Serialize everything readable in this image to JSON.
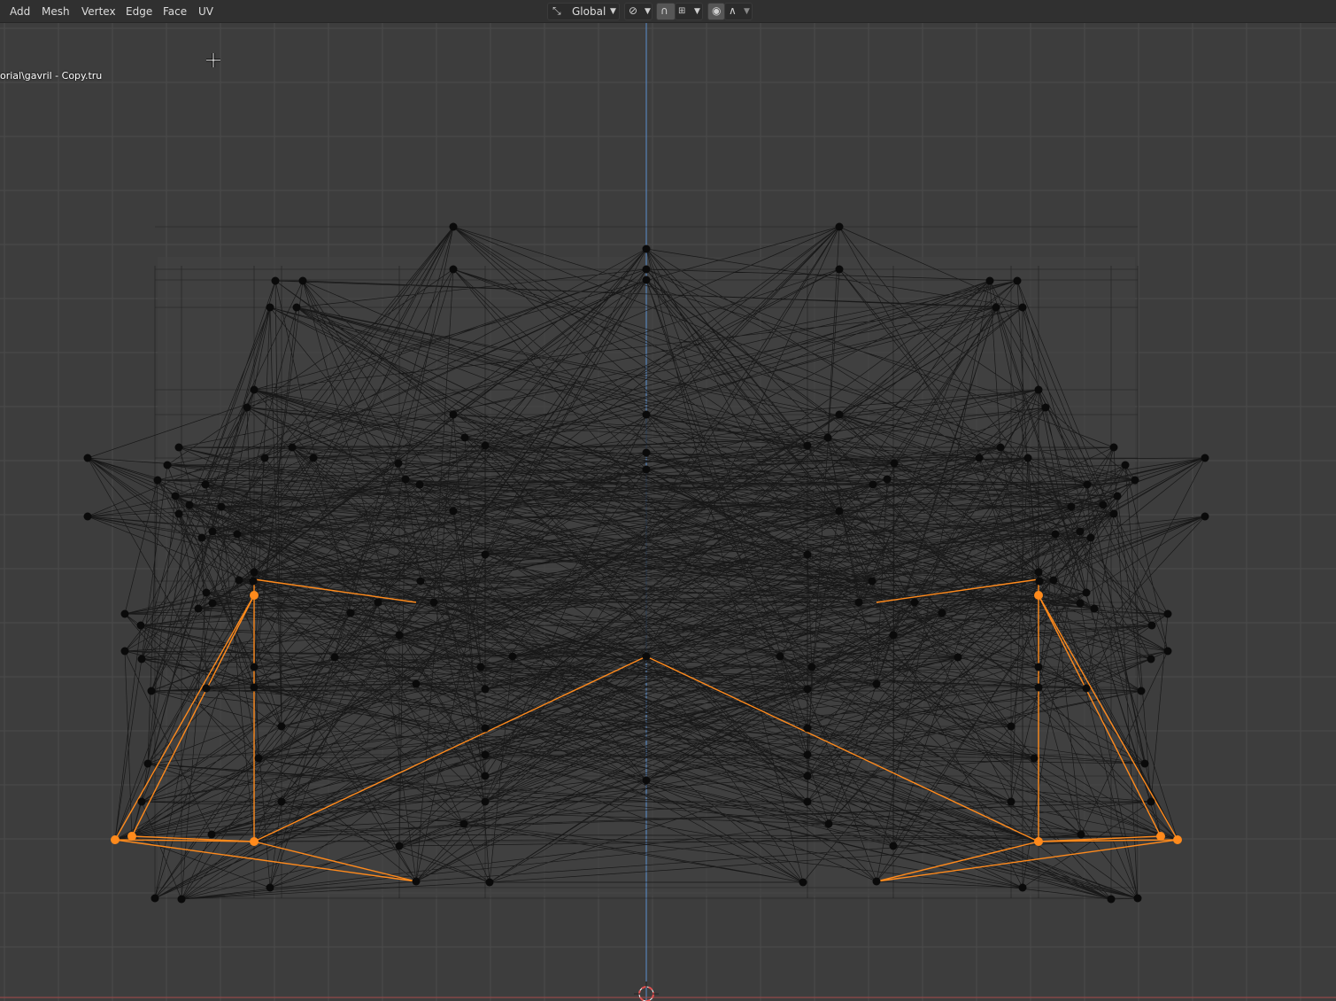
{
  "header": {
    "menu": [
      "Add",
      "Mesh",
      "Vertex",
      "Edge",
      "Face",
      "UV"
    ],
    "orientation": "Global",
    "icons": {
      "orientation": "transform-orientation-icon",
      "pivot": "pivot-point-icon",
      "snap": "snap-magnet-icon",
      "snap_target": "snap-increment-icon",
      "proportional": "proportional-editing-icon",
      "falloff": "falloff-curve-icon"
    }
  },
  "viewport": {
    "file_path": "orial\\gavril - Copy.tru",
    "colors": {
      "background": "#3d3d3d",
      "grid": "#4a4a4a",
      "axis": "#5a8fd0",
      "vertex": "#0a0a0a",
      "selected": "#ff8a1c",
      "edge": "#141414"
    }
  }
}
